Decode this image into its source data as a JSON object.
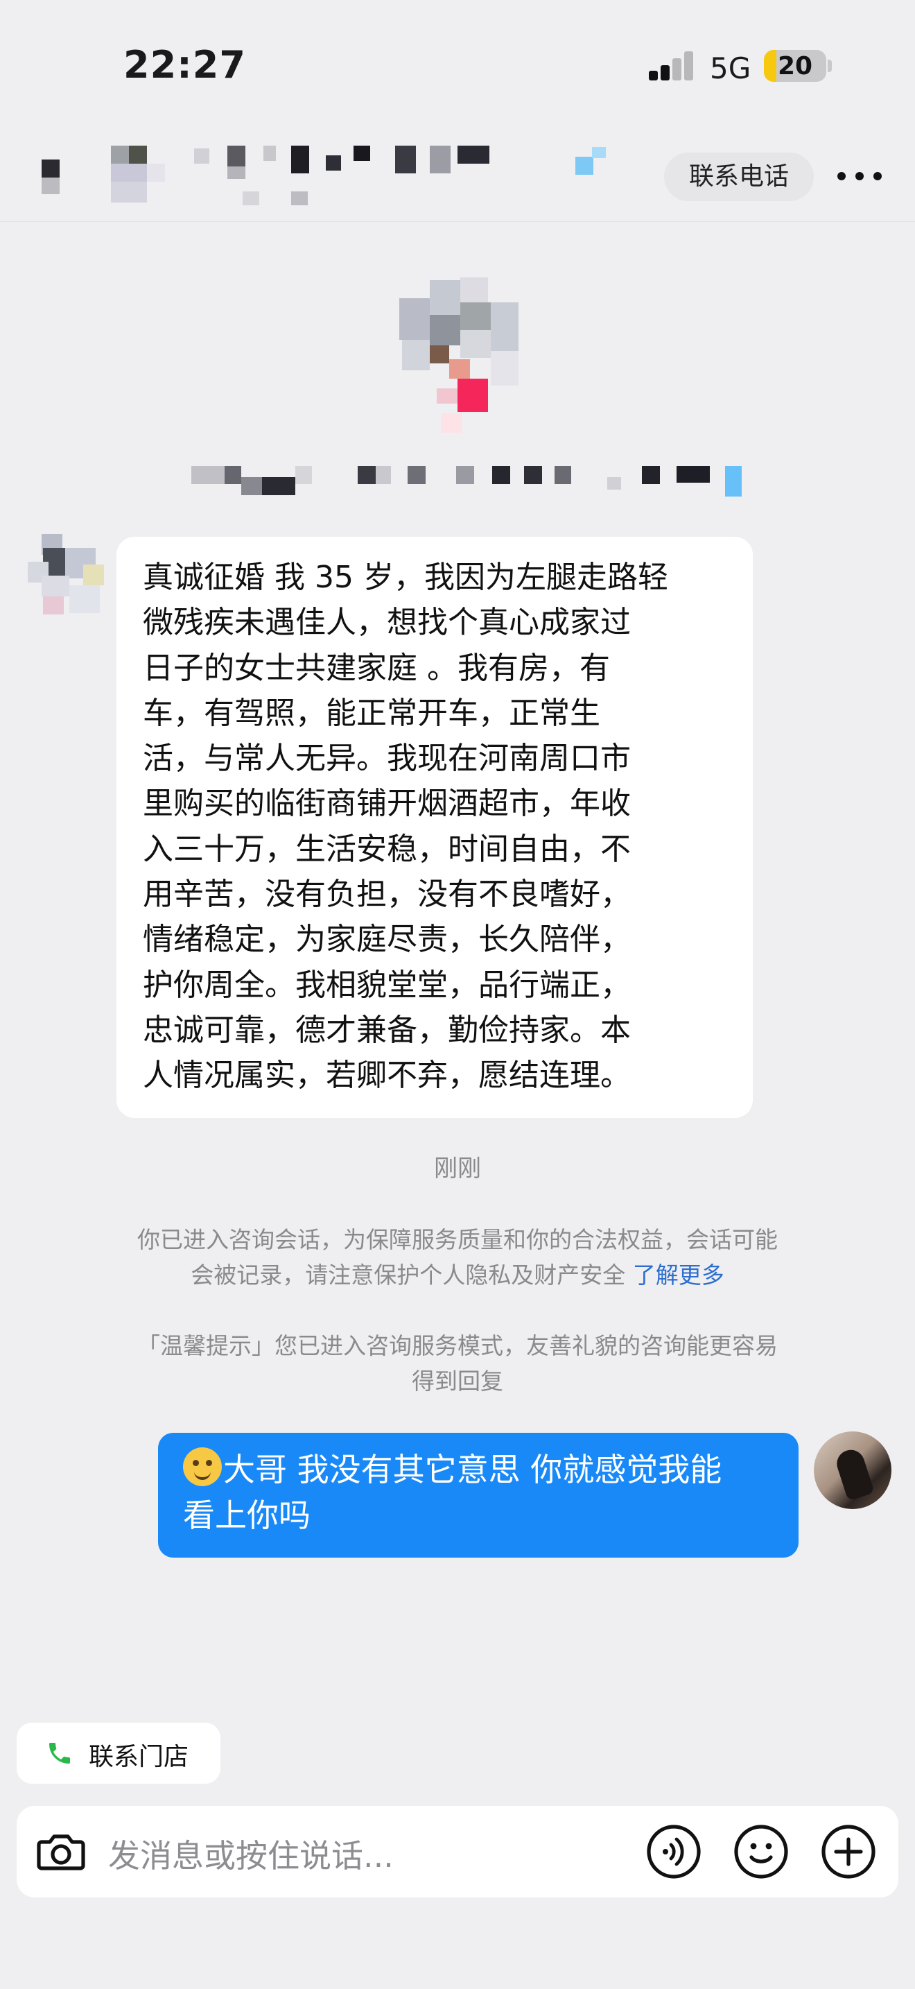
{
  "status_bar": {
    "time": "22:27",
    "network": "5G",
    "battery": "20",
    "battery_level": 0.2
  },
  "header": {
    "call_label": "联系电话"
  },
  "incoming_message": {
    "lines": [
      "真诚征婚 我 35 岁，我因为左腿走路轻",
      "微残疾未遇佳人，想找个真心成家过",
      "日子的女士共建家庭 。我有房，有",
      "车，有驾照，能正常开车，正常生",
      "活，与常人无异。我现在河南周口市",
      "里购买的临街商铺开烟酒超市，年收",
      "入三十万，生活安稳，时间自由，不",
      "用辛苦，没有负担，没有不良嗜好，",
      "情绪稳定，为家庭尽责，长久陪伴，",
      "护你周全。我相貌堂堂，品行端正，",
      "忠诚可靠，德才兼备，勤俭持家。本",
      "人情况属实，若卿不弃，愿结连理。"
    ]
  },
  "timestamp": "刚刚",
  "system_notice": {
    "line1": "你已进入咨询会话，为保障服务质量和你的合法权益，会话可能",
    "line2": "会被记录，请注意保护个人隐私及财产安全",
    "link": "了解更多"
  },
  "tip_notice": {
    "line1": "「温馨提示」您已进入咨询服务模式，友善礼貌的咨询能更容易",
    "line2": "得到回复"
  },
  "outgoing_message": {
    "line1": "大哥 我没有其它意思 你就感觉我能",
    "line2": "看上你吗"
  },
  "store_button": {
    "label": "联系门店"
  },
  "input": {
    "placeholder": "发消息或按住说话..."
  },
  "colors": {
    "accent": "#1a89f8",
    "background": "#efeff1",
    "link": "#2c6ecf",
    "phone_green": "#2bb84a"
  }
}
